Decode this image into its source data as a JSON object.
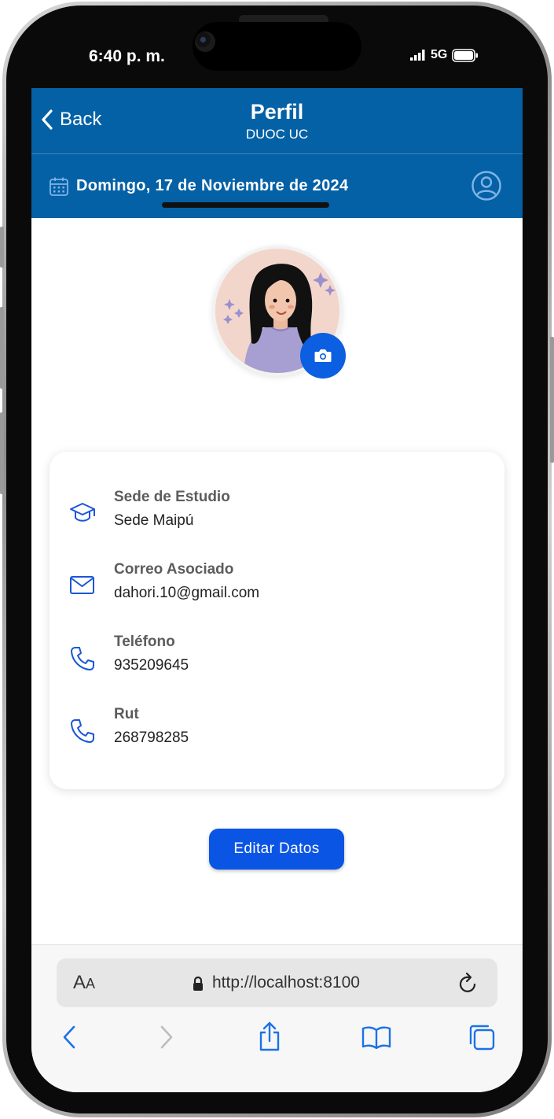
{
  "status_bar": {
    "time": "6:40 p. m.",
    "network": "5G"
  },
  "header": {
    "back_label": "Back",
    "title": "Perfil",
    "subtitle": "DUOC UC"
  },
  "date_bar": {
    "date_text": "Domingo, 17 de Noviembre de 2024"
  },
  "profile_card": {
    "items": [
      {
        "label": "Sede de Estudio",
        "value": "Sede Maipú",
        "icon": "graduation-cap-icon"
      },
      {
        "label": "Correo Asociado",
        "value": "dahori.10@gmail.com",
        "icon": "mail-icon"
      },
      {
        "label": "Teléfono",
        "value": "935209645",
        "icon": "phone-icon"
      },
      {
        "label": "Rut",
        "value": "268798285",
        "icon": "phone-icon"
      }
    ]
  },
  "edit_button": {
    "label": "Editar Datos"
  },
  "browser": {
    "text_size_label": "AA",
    "url": "http://localhost:8100"
  },
  "colors": {
    "header_blue": "#0561a5",
    "button_blue": "#0b55e4",
    "icon_blue": "#1a56d6"
  }
}
